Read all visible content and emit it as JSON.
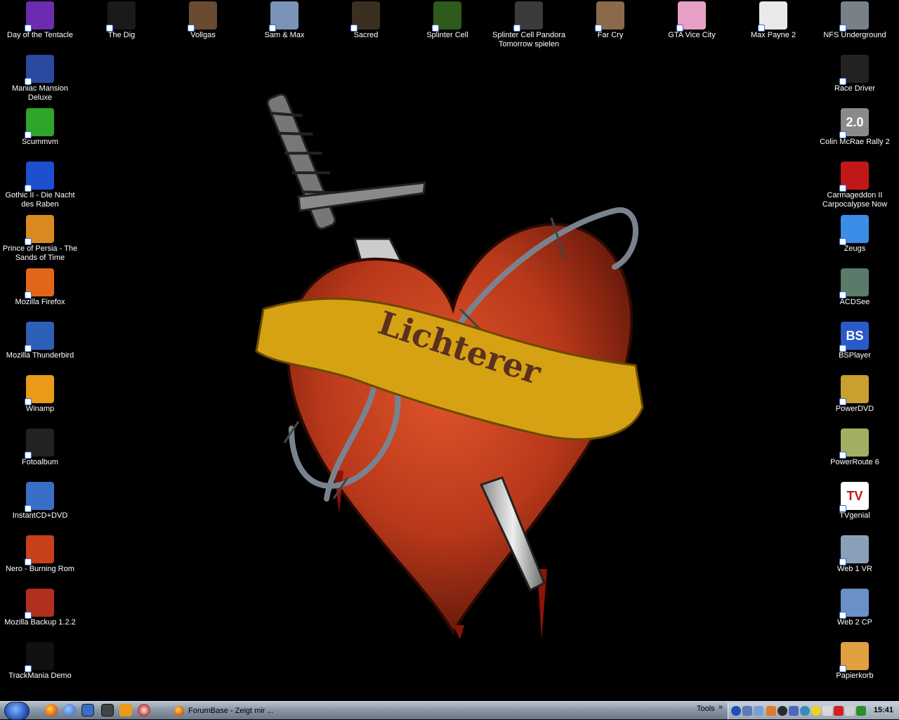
{
  "desktop": {
    "wallpaper_text": "Lichterer",
    "icons_top": [
      {
        "label": "Day of the Tentacle",
        "icon": "tentacle-icon",
        "color": "#6c2bb0"
      },
      {
        "label": "The Dig",
        "icon": "the-dig-logo-icon",
        "color": "#1a1a1a"
      },
      {
        "label": "Vollgas",
        "icon": "biker-face-icon",
        "color": "#6b4a32"
      },
      {
        "label": "Sam & Max",
        "icon": "sam-max-icon",
        "color": "#7a94b8"
      },
      {
        "label": "Sacred",
        "icon": "sacred-emblem-icon",
        "color": "#3b3020"
      },
      {
        "label": "Splinter Cell",
        "icon": "splinter-cell-icon",
        "color": "#2e5a1c"
      },
      {
        "label": "Splinter Cell Pandora Tomorrow spielen",
        "icon": "splinter-cell-pandora-icon",
        "color": "#3b3b3b"
      },
      {
        "label": "Far Cry",
        "icon": "far-cry-icon",
        "color": "#8a6a4a"
      },
      {
        "label": "GTA Vice City",
        "icon": "vice-city-icon",
        "color": "#e8a0c8"
      },
      {
        "label": "Max Payne 2",
        "icon": "max-payne-icon",
        "color": "#eaeaea"
      },
      {
        "label": "NFS Underground",
        "icon": "wheel-rim-icon",
        "color": "#7a8088"
      }
    ],
    "icons_left": [
      {
        "label": "Maniac Mansion Deluxe",
        "icon": "maniac-mansion-icon",
        "color": "#2a4aa0"
      },
      {
        "label": "Scummvm",
        "icon": "scummvm-icon",
        "color": "#2fa52a"
      },
      {
        "label": "Gothic II - Die Nacht des Raben",
        "icon": "gothic-g-icon",
        "color": "#1e4fd0"
      },
      {
        "label": "Prince of Persia - The Sands of Time",
        "icon": "prince-persia-icon",
        "color": "#d88a20"
      },
      {
        "label": "Mozilla Firefox",
        "icon": "firefox-icon",
        "color": "#e2661a"
      },
      {
        "label": "Mozilla Thunderbird",
        "icon": "thunderbird-icon",
        "color": "#2d5fb8"
      },
      {
        "label": "Winamp",
        "icon": "winamp-icon",
        "color": "#e89a18"
      },
      {
        "label": "Fotoalbum",
        "icon": "camera-icon",
        "color": "#222222"
      },
      {
        "label": "InstantCD+DVD",
        "icon": "instantcd-icon",
        "color": "#3a6fc8"
      },
      {
        "label": "Nero - Burning Rom",
        "icon": "nero-colosseum-icon",
        "color": "#c8401a"
      },
      {
        "label": "Mozilla Backup 1.2.2",
        "icon": "mozilla-backup-icon",
        "color": "#b03020"
      },
      {
        "label": "TrackMania Demo",
        "icon": "trackmania-icon",
        "color": "#111111"
      }
    ],
    "icons_right": [
      {
        "label": "Race Driver",
        "icon": "race-driver-wheel-icon",
        "color": "#222222"
      },
      {
        "label": "Colin McRae Rally 2",
        "icon": "colin-mcrae-2-icon",
        "color": "#8a8a8a",
        "glyph": "2.0"
      },
      {
        "label": "Carmageddon II Carpocalypse Now",
        "icon": "carmageddon-icon",
        "color": "#c01818"
      },
      {
        "label": "Zeugs",
        "icon": "folder-icon",
        "color": "#3a8ee8"
      },
      {
        "label": "ACDSee",
        "icon": "acdsee-eye-icon",
        "color": "#5a7a6a"
      },
      {
        "label": "BSPlayer",
        "icon": "bsplayer-icon",
        "color": "#2a5ac8",
        "glyph": "BS"
      },
      {
        "label": "PowerDVD",
        "icon": "powerdvd-icon",
        "color": "#c8a030"
      },
      {
        "label": "PowerRoute 6",
        "icon": "powerroute-icon",
        "color": "#a0b060"
      },
      {
        "label": "TVgenial",
        "icon": "tvgenial-icon",
        "color": "#ffffff",
        "glyph": "TV"
      },
      {
        "label": "Web 1 VR",
        "icon": "network-computer-icon",
        "color": "#8aa0b8"
      },
      {
        "label": "Web 2 CP",
        "icon": "network-computer-icon",
        "color": "#6a90c8"
      },
      {
        "label": "Papierkorb",
        "icon": "recycle-bin-icon",
        "color": "#e0a040"
      }
    ]
  },
  "taskbar": {
    "task_label": "ForumBase - Zeigt mir ...",
    "tools_label": "Tools",
    "tools_chevron": "»",
    "clock": "15:41"
  },
  "colors": {
    "banner": "#d6a213",
    "heart": "#b8381a",
    "heart_dark": "#6e1a0c",
    "banner_text": "#5a3020"
  }
}
